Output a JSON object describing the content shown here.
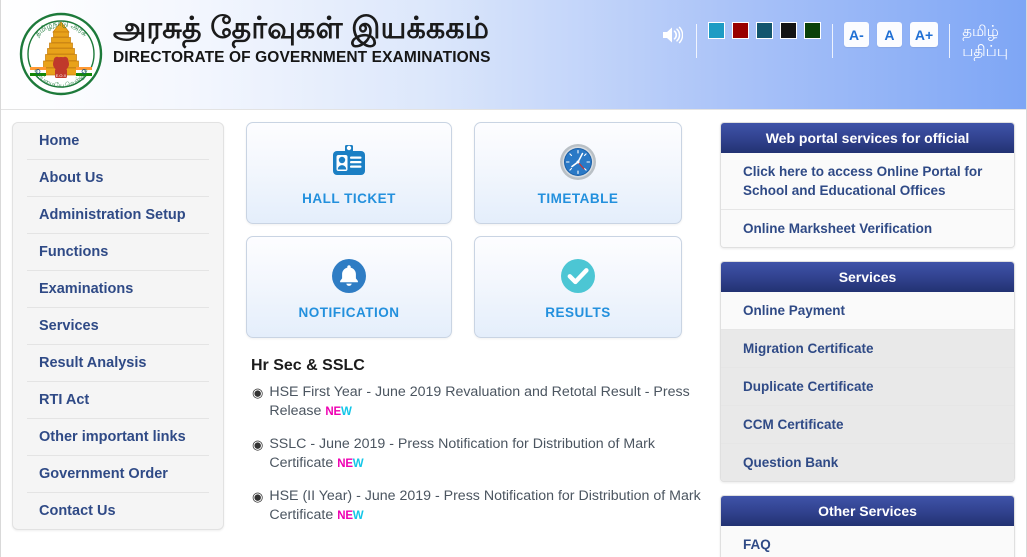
{
  "header": {
    "emblem_name": "tamil-nadu-state-emblem",
    "title_tamil": "அரசுத் தேர்வுகள் இயக்ககம்",
    "title_english": "DIRECTORATE OF GOVERNMENT EXAMINATIONS",
    "speaker_icon": "speaker-icon",
    "swatches": [
      {
        "name": "theme-cyan",
        "color": "#1e9cc4"
      },
      {
        "name": "theme-dark-red",
        "color": "#990000"
      },
      {
        "name": "theme-teal",
        "color": "#13566e"
      },
      {
        "name": "theme-black",
        "color": "#141414"
      },
      {
        "name": "theme-dark-green",
        "color": "#0b4208"
      }
    ],
    "font_decrease": "A-",
    "font_normal": "A",
    "font_increase": "A+",
    "language_link": "தமிழ்\nபதிப்பு"
  },
  "sidebar": {
    "items": [
      {
        "label": "Home"
      },
      {
        "label": "About Us"
      },
      {
        "label": "Administration Setup"
      },
      {
        "label": "Functions"
      },
      {
        "label": "Examinations"
      },
      {
        "label": "Services"
      },
      {
        "label": "Result Analysis"
      },
      {
        "label": "RTI Act"
      },
      {
        "label": "Other important links"
      },
      {
        "label": "Government Order"
      },
      {
        "label": "Contact Us"
      }
    ]
  },
  "main": {
    "cards": [
      {
        "label": "HALL TICKET",
        "icon": "id-badge-icon"
      },
      {
        "label": "TIMETABLE",
        "icon": "clock-icon"
      },
      {
        "label": "NOTIFICATION",
        "icon": "bell-icon"
      },
      {
        "label": "RESULTS",
        "icon": "check-circle-icon"
      }
    ],
    "news_heading": "Hr Sec & SSLC",
    "news": [
      {
        "text": "HSE First Year - June 2019 Revaluation and Retotal Result - Press Release",
        "badge": "NEW"
      },
      {
        "text": "SSLC - June 2019 - Press Notification for Distribution of Mark Certificate",
        "badge": "NEW"
      },
      {
        "text": "HSE (II Year) - June 2019 - Press Notification for Distribution of Mark Certificate",
        "badge": "NEW"
      }
    ]
  },
  "right_panels": [
    {
      "title": "Web portal services for official",
      "rows": [
        {
          "label": "Click here to access Online Portal for School and Educational Offices"
        },
        {
          "label": "Online Marksheet Verification"
        }
      ]
    },
    {
      "title": "Services",
      "rows": [
        {
          "label": "Online Payment"
        },
        {
          "label": "Migration Certificate"
        },
        {
          "label": "Duplicate Certificate"
        },
        {
          "label": "CCM Certificate"
        },
        {
          "label": "Question Bank"
        }
      ]
    },
    {
      "title": "Other Services",
      "rows": [
        {
          "label": "FAQ"
        }
      ]
    }
  ],
  "colors": {
    "brand_blue": "#2f4a86",
    "panel_header": "#31428f",
    "card_label": "#2390dd",
    "badge_magenta": "#ef00b2",
    "badge_cyan": "#13c6e8"
  }
}
